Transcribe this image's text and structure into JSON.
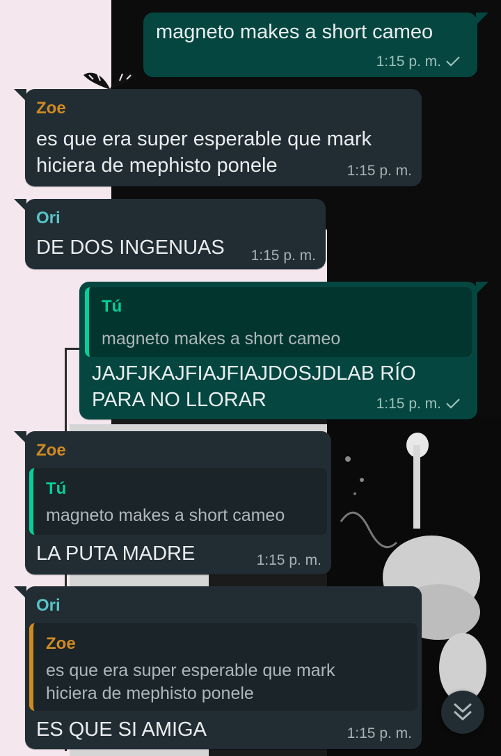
{
  "colors": {
    "incoming_bubble": "#222d33",
    "outgoing_bubble": "#054740",
    "zoe_name": "#d08a22",
    "ori_name": "#56c4c8",
    "you_name": "#06cf9c",
    "timestamp": "#a8b3b8"
  },
  "messages": [
    {
      "direction": "outgoing",
      "text": "magneto makes a short cameo",
      "time": "1:15 p. m.",
      "status_icon": "single-check-icon"
    },
    {
      "direction": "incoming",
      "sender": "Zoe",
      "text_lines": [
        "es que era super esperable que mark",
        "hiciera de mephisto ponele"
      ],
      "time": "1:15 p. m."
    },
    {
      "direction": "incoming",
      "sender": "Ori",
      "text": "DE DOS INGENUAS",
      "time": "1:15 p. m."
    },
    {
      "direction": "outgoing",
      "quote": {
        "sender": "Tú",
        "text": "magneto makes a short cameo"
      },
      "text_lines": [
        "JAJFJKAJFIAJFIAJDOSJDLAB RÍO",
        "PARA NO LLORAR"
      ],
      "time": "1:15 p. m.",
      "status_icon": "single-check-icon"
    },
    {
      "direction": "incoming",
      "sender": "Zoe",
      "quote": {
        "sender": "Tú",
        "text": "magneto makes a short cameo"
      },
      "text": "LA PUTA MADRE",
      "time": "1:15 p. m."
    },
    {
      "direction": "incoming",
      "sender": "Ori",
      "quote": {
        "sender": "Zoe",
        "text_lines": [
          "es que era super esperable que mark",
          "hiciera de mephisto ponele"
        ]
      },
      "text": "ES QUE SI AMIGA",
      "time": "1:15 p. m."
    }
  ],
  "scroll_button": {
    "icon": "double-chevron-down-icon"
  }
}
